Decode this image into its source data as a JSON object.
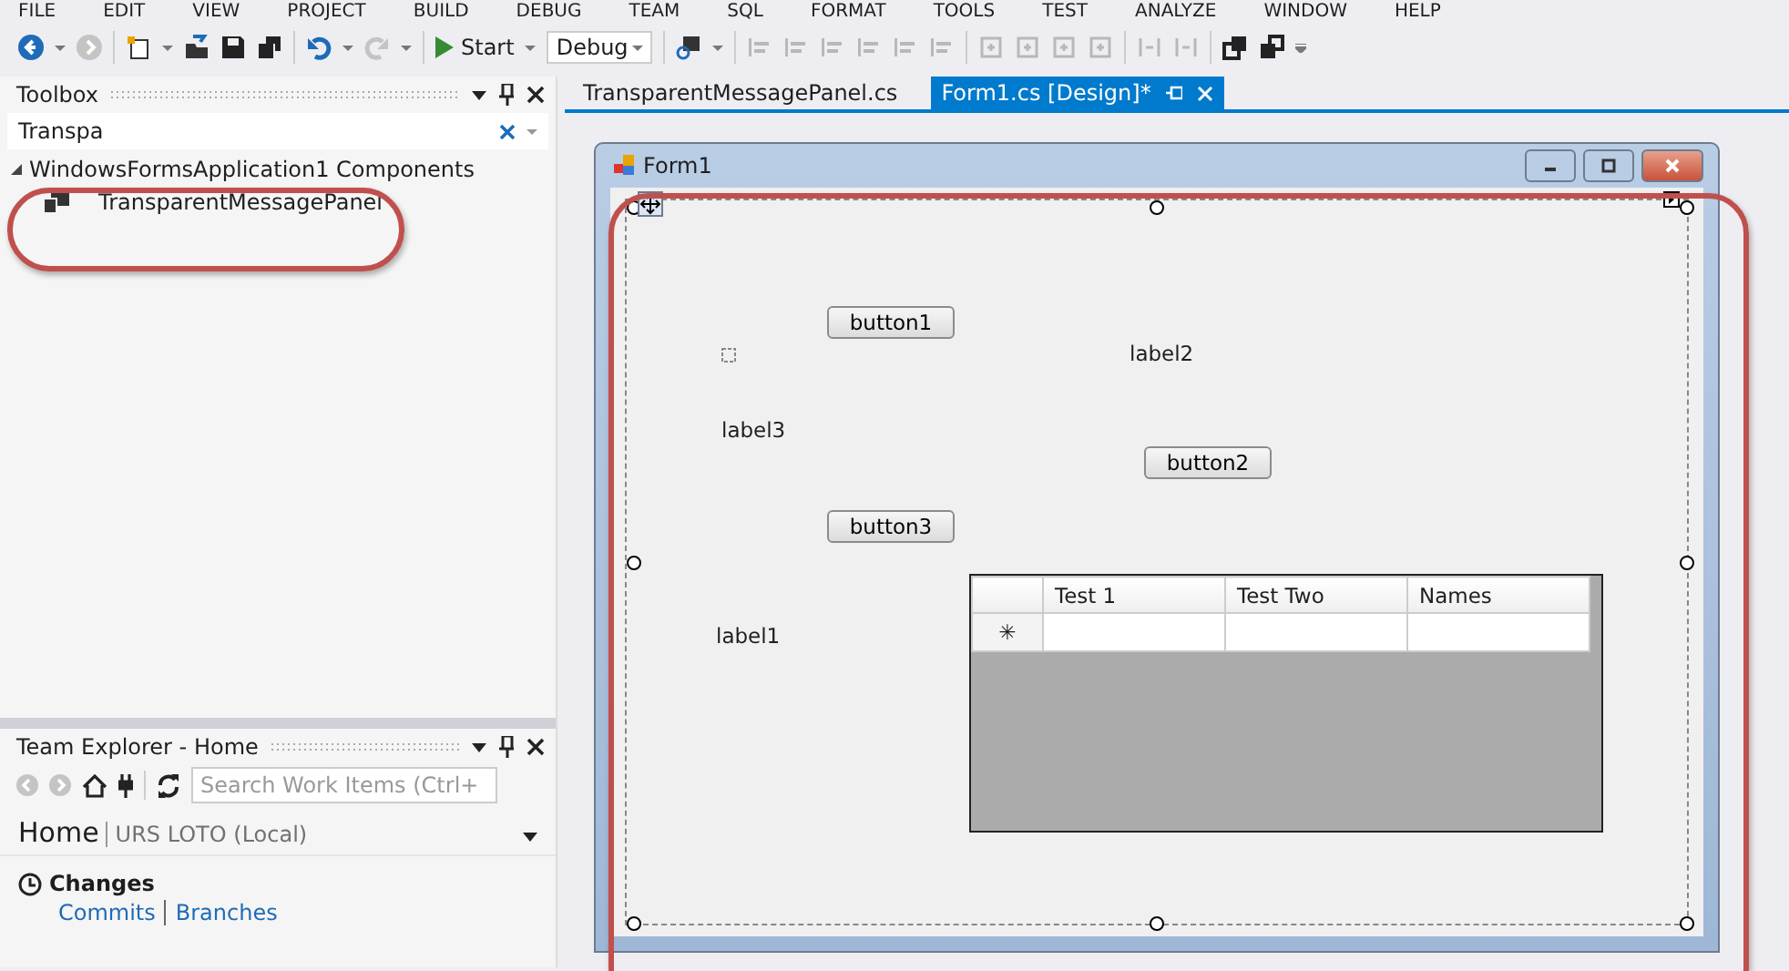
{
  "menu": [
    "FILE",
    "EDIT",
    "VIEW",
    "PROJECT",
    "BUILD",
    "DEBUG",
    "TEAM",
    "SQL",
    "FORMAT",
    "TOOLS",
    "TEST",
    "ANALYZE",
    "WINDOW",
    "HELP"
  ],
  "toolbar": {
    "start": "Start",
    "config": "Debug"
  },
  "toolbox": {
    "title": "Toolbox",
    "search": "Transpa",
    "groups": [
      {
        "label": "WindowsFormsApplication1 Components",
        "expanded": true,
        "children": [
          {
            "label": "TransparentMessagePanel"
          }
        ]
      }
    ]
  },
  "team_explorer": {
    "title": "Team Explorer - Home",
    "search_placeholder": "Search Work Items (Ctrl+",
    "home": "Home",
    "project": "URS LOTO (Local)",
    "section": "Changes",
    "links": [
      "Commits",
      "Branches"
    ]
  },
  "tabs": [
    {
      "label": "TransparentMessagePanel.cs",
      "selected": false
    },
    {
      "label": "Form1.cs [Design]*",
      "selected": true
    }
  ],
  "form": {
    "title": "Form1",
    "controls": [
      {
        "kind": "button",
        "text": "button1"
      },
      {
        "kind": "label",
        "text": "label2"
      },
      {
        "kind": "label",
        "text": "label3"
      },
      {
        "kind": "button",
        "text": "button2"
      },
      {
        "kind": "button",
        "text": "button3"
      },
      {
        "kind": "label",
        "text": "label1"
      }
    ],
    "grid": {
      "columns": [
        "Test 1",
        "Test Two",
        "Names"
      ],
      "new_row_marker": "✳"
    }
  }
}
